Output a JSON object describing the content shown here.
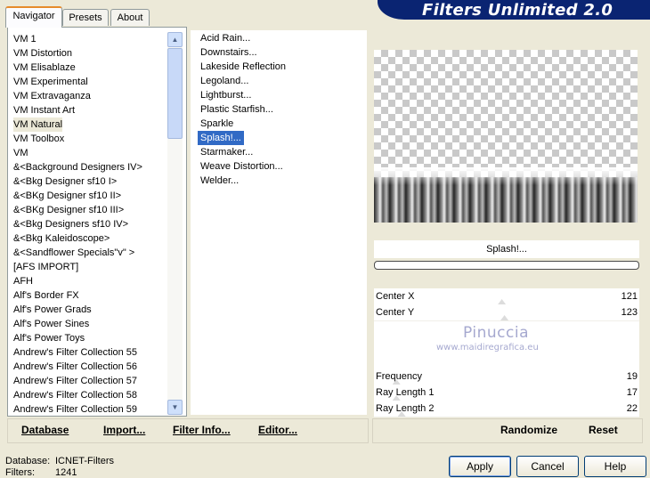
{
  "header": {
    "title": "Filters Unlimited 2.0"
  },
  "tabs": [
    {
      "label": "Navigator",
      "active": true
    },
    {
      "label": "Presets",
      "active": false
    },
    {
      "label": "About",
      "active": false
    }
  ],
  "categories": [
    "VM 1",
    "VM Distortion",
    "VM Elisablaze",
    "VM Experimental",
    "VM Extravaganza",
    "VM Instant Art",
    "VM Natural",
    "VM Toolbox",
    "VM",
    "&<Background Designers IV>",
    "&<Bkg Designer sf10 I>",
    "&<BKg Designer sf10 II>",
    "&<BKg Designer sf10 III>",
    "&<Bkg Designers sf10 IV>",
    "&<Bkg Kaleidoscope>",
    "&<Sandflower Specials\"v\" >",
    "[AFS IMPORT]",
    "AFH",
    "Alf's Border FX",
    "Alf's Power Grads",
    "Alf's Power Sines",
    "Alf's Power Toys",
    "Andrew's Filter Collection 55",
    "Andrew's Filter Collection 56",
    "Andrew's Filter Collection 57",
    "Andrew's Filter Collection 58",
    "Andrew's Filter Collection 59"
  ],
  "selected_category": "VM Natural",
  "filters": [
    "Acid Rain...",
    "Downstairs...",
    "Lakeside Reflection",
    "Legoland...",
    "Lightburst...",
    "Plastic Starfish...",
    "Sparkle",
    "Splash!...",
    "Starmaker...",
    "Weave Distortion...",
    "Welder..."
  ],
  "selected_filter": "Splash!...",
  "filter_name": "Splash!...",
  "params": [
    {
      "label": "Center X",
      "value": "121",
      "level": 0.47
    },
    {
      "label": "Center Y",
      "value": "123",
      "level": 0.48
    },
    {
      "label": "Frequency",
      "value": "19",
      "level": 0.07
    },
    {
      "label": "Ray Length 1",
      "value": "17",
      "level": 0.07
    },
    {
      "label": "Ray Length 2",
      "value": "22",
      "level": 0.09
    }
  ],
  "watermark": {
    "line1": "Pinuccia",
    "line2": "www.maidiregrafica.eu"
  },
  "left_buttons": {
    "database": "Database",
    "import": "Import...",
    "filter_info": "Filter Info...",
    "editor": "Editor..."
  },
  "right_buttons": {
    "randomize": "Randomize",
    "reset": "Reset"
  },
  "status": {
    "database_label": "Database:",
    "database_value": "ICNET-Filters",
    "filters_label": "Filters:",
    "filters_value": "1241"
  },
  "dialog_buttons": {
    "apply": "Apply",
    "cancel": "Cancel",
    "help": "Help"
  },
  "colors": {
    "banner": "#0a2472",
    "selection": "#316ac5"
  }
}
